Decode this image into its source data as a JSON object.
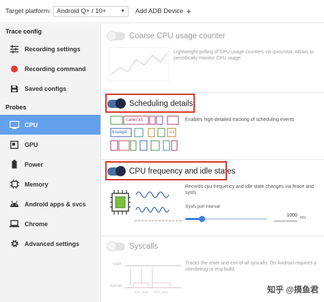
{
  "topbar": {
    "platform_label": "Target platform:",
    "platform_value": "Android Q+ / 10+",
    "add_adb_label": "Add ADB Device"
  },
  "sidebar": {
    "trace_config_title": "Trace config",
    "trace_items": [
      {
        "label": "Recording settings",
        "icon": "sliders-icon"
      },
      {
        "label": "Recording command",
        "icon": "record-dot-icon"
      },
      {
        "label": "Saved configs",
        "icon": "save-icon"
      }
    ],
    "probes_title": "Probes",
    "probe_items": [
      {
        "label": "CPU",
        "icon": "cpu-icon",
        "active": true
      },
      {
        "label": "GPU",
        "icon": "gpu-icon"
      },
      {
        "label": "Power",
        "icon": "battery-icon"
      },
      {
        "label": "Memory",
        "icon": "memory-icon"
      },
      {
        "label": "Android apps & svcs",
        "icon": "android-icon"
      },
      {
        "label": "Chrome",
        "icon": "laptop-icon"
      },
      {
        "label": "Advanced settings",
        "icon": "gear-icon"
      }
    ]
  },
  "probes": {
    "coarse": {
      "title": "Coarse CPU usage counter",
      "enabled": false,
      "desc": "Lightweight polling of CPU usage counters via /proc/stat. Allows to periodically monitor CPU usage."
    },
    "sched": {
      "title": "Scheduling details",
      "enabled": true,
      "desc": "Enables high-detailed tracking of scheduling events",
      "img_labels": [
        "cameraS",
        "kswapd",
        "ui"
      ]
    },
    "freq": {
      "title": "CPU frequency and idle states",
      "enabled": true,
      "desc": "Records cpu frequency and idle state changes via ftrace and sysfs",
      "slider_label": "Sysfs poll interval",
      "slider_fraction": 0.2,
      "value": "1000",
      "unit": "ms"
    },
    "syscalls": {
      "title": "Syscalls",
      "enabled": false,
      "desc": "Tracks the enter and exit of all syscalls. On Android requires a userdebug or eng build.",
      "img_labels": [
        "User",
        "Kernel",
        "SYS_read",
        "SYS_read"
      ]
    }
  },
  "watermark": "知乎 @摸鱼君",
  "colors": {
    "active_nav": "#64a0ec",
    "highlight": "#d93025",
    "toggle_on": "#1f2a44",
    "slider": "#3f7fd8"
  }
}
